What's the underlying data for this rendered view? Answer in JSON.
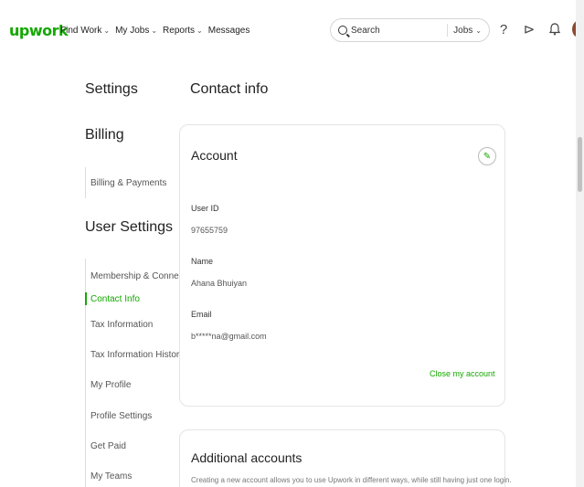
{
  "nav": {
    "logo": "upwork",
    "links": [
      {
        "label": "Find Work",
        "caret": "⌄"
      },
      {
        "label": "My Jobs",
        "caret": "⌄"
      },
      {
        "label": "Reports",
        "caret": "⌄"
      },
      {
        "label": "Messages",
        "caret": ""
      }
    ],
    "search": {
      "placeholder": "Search",
      "scope": "Jobs",
      "caret": "⌄"
    },
    "help_icon": "?",
    "direct_icon": "⊳",
    "bell_icon": "🔔"
  },
  "sidebar": {
    "title": "Settings",
    "billing_heading": "Billing",
    "billing_items": [
      "Billing & Payments"
    ],
    "user_heading": "User Settings",
    "user_items": [
      "Membership & Connects",
      "Contact Info",
      "Tax Information",
      "Tax Information History",
      "My Profile",
      "Profile Settings",
      "Get Paid",
      "My Teams"
    ]
  },
  "main": {
    "title": "Contact info",
    "account": {
      "title": "Account",
      "edit_icon": "✎",
      "fields": [
        {
          "label": "User ID",
          "value": "97655759"
        },
        {
          "label": "Name",
          "value": "Ahana Bhuiyan"
        },
        {
          "label": "Email",
          "value": "b*****na@gmail.com"
        }
      ],
      "close_link": "Close my account"
    },
    "additional": {
      "title": "Additional accounts",
      "description": "Creating a new account allows you to use Upwork in different ways, while still having just one login."
    }
  },
  "colors": {
    "brand": "#14a800"
  }
}
